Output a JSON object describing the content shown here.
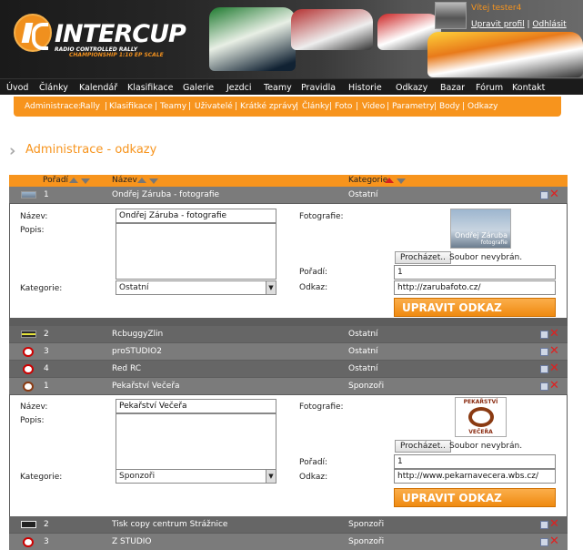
{
  "header": {
    "title": "INTERCUP",
    "subtitle": "RADIO CONTROLLED RALLY",
    "subtitle2": "CHAMPIONSHIP 1:10 EP SCALE",
    "welcome": "Vítej tester4",
    "edit_profile": "Upravit profil",
    "separator": "|",
    "logout": "Odhlásit"
  },
  "mainnav": [
    "Úvod",
    "Články",
    "Kalendář",
    "Klasifikace",
    "Galerie",
    "Jezdci",
    "Teamy",
    "Pravidla",
    "Historie",
    "Odkazy",
    "Bazar",
    "Fórum",
    "Kontakt"
  ],
  "subnav": {
    "label": "Administrace:",
    "items": [
      "Rally",
      "Klasifikace",
      "Teamy",
      "Uživatelé",
      "Krátké zprávy",
      "Články",
      "Foto",
      "Video",
      "Parametry",
      "Body",
      "Odkazy"
    ]
  },
  "page": {
    "title": "Administrace - odkazy"
  },
  "table": {
    "col_order": "Pořadí",
    "col_name": "Název",
    "col_category": "Kategorie"
  },
  "form": {
    "label_name": "Název:",
    "label_desc": "Popis:",
    "label_category": "Kategorie:",
    "label_photo": "Fotografie:",
    "label_order": "Pořadí:",
    "label_link": "Odkaz:",
    "browse": "Procházet..",
    "no_file": "Soubor nevybrán.",
    "submit": "UPRAVIT ODKAZ"
  },
  "rows": [
    {
      "order": "1",
      "name": "Ondřej Záruba - fotografie",
      "category": "Ostatní"
    },
    {
      "order": "2",
      "name": "RcbuggyZlin",
      "category": "Ostatní"
    },
    {
      "order": "3",
      "name": "proSTUDIO2",
      "category": "Ostatní"
    },
    {
      "order": "4",
      "name": "Red RC",
      "category": "Ostatní"
    },
    {
      "order": "1",
      "name": "Pekařství Večeřa",
      "category": "Sponzoři"
    },
    {
      "order": "2",
      "name": "Tisk copy centrum Strážnice",
      "category": "Sponzoři"
    },
    {
      "order": "3",
      "name": "Z STUDIO",
      "category": "Sponzoři"
    }
  ],
  "panel1": {
    "name": "Ondřej Záruba - fotografie",
    "category": "Ostatní",
    "order": "1",
    "link": "http://zarubafoto.cz/",
    "photo_caption": "Ondřej Záruba",
    "photo_caption2": "fotografie"
  },
  "panel2": {
    "name": "Pekařství Večeřa",
    "category": "Sponzoři",
    "order": "1",
    "link": "http://www.pekarnavecera.wbs.cz/",
    "photo_top": "PEKAŘSTVÍ",
    "photo_bottom": "VEČEŘA"
  },
  "colors": {
    "accent": "#f7941d",
    "delete": "#e02020"
  }
}
